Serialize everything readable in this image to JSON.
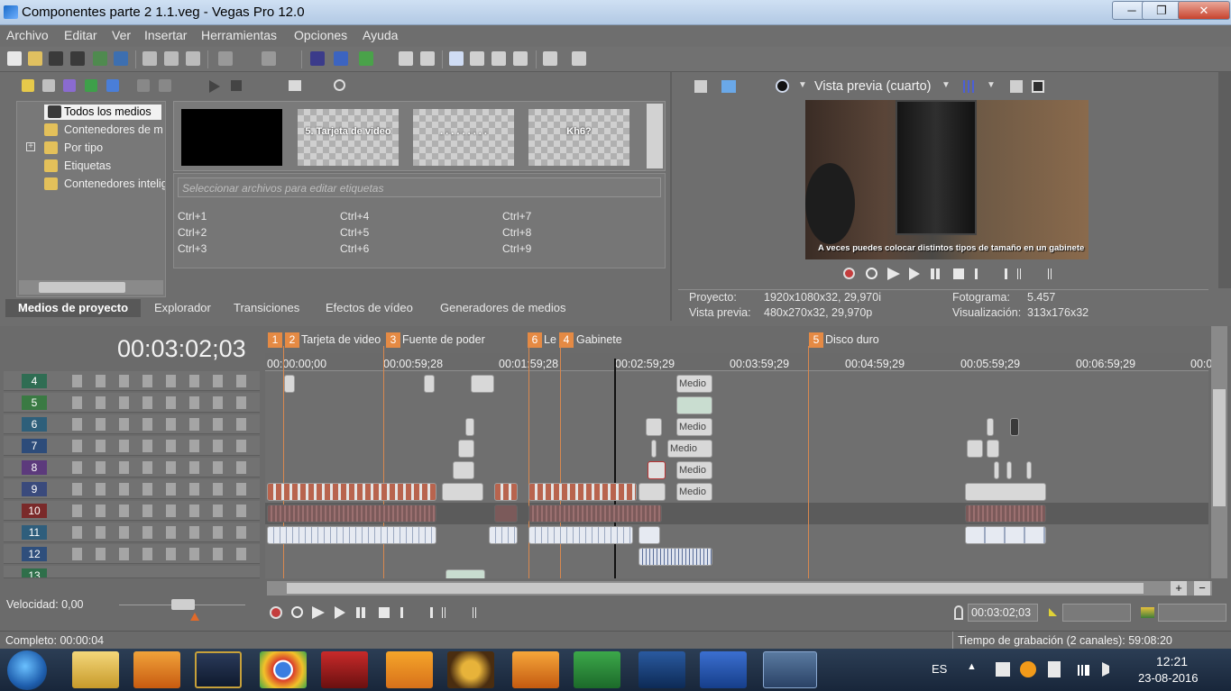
{
  "window": {
    "title": "Componentes parte 2 1.1.veg - Vegas Pro 12.0",
    "minimize": "─",
    "maximize": "❐",
    "close": "✕"
  },
  "menu": [
    "Archivo",
    "Editar",
    "Ver",
    "Insertar",
    "Herramientas",
    "Opciones",
    "Ayuda"
  ],
  "media": {
    "tree": [
      "Todos los medios",
      "Contenedores de m",
      "Por tipo",
      "Etiquetas",
      "Contenedores intelig"
    ],
    "thumbs": [
      "",
      "5. Tarjeta de video",
      ". . . . . . . . .",
      "Kh6?"
    ],
    "tag_placeholder": "Seleccionar archivos para editar etiquetas",
    "shortcuts": [
      "Ctrl+1",
      "Ctrl+4",
      "Ctrl+7",
      "Ctrl+2",
      "Ctrl+5",
      "Ctrl+8",
      "Ctrl+3",
      "Ctrl+6",
      "Ctrl+9"
    ],
    "tabs": [
      "Medios de proyecto",
      "Explorador",
      "Transiciones",
      "Efectos de vídeo",
      "Generadores de medios"
    ]
  },
  "preview": {
    "mode": "Vista previa (cuarto)",
    "subtitle": "A veces puedes colocar distintos tipos de tamaño en un gabinete",
    "proyecto_label": "Proyecto:",
    "proyecto_value": "1920x1080x32, 29,970i",
    "vista_label": "Vista previa:",
    "vista_value": "480x270x32, 29,970p",
    "fotograma_label": "Fotograma:",
    "fotograma_value": "5.457",
    "visual_label": "Visualización:",
    "visual_value": "313x176x32"
  },
  "timeline": {
    "time": "00:03:02;03",
    "markers": [
      {
        "n": "1",
        "label": ""
      },
      {
        "n": "2",
        "label": "Tarjeta de video"
      },
      {
        "n": "3",
        "label": "Fuente de poder"
      },
      {
        "n": "6",
        "label": "Le"
      },
      {
        "n": "4",
        "label": "Gabinete"
      },
      {
        "n": "5",
        "label": "Disco duro"
      }
    ],
    "ruler": [
      "00:00:00;00",
      "00:00:59;28",
      "00:01:59;28",
      "00:02:59;29",
      "00:03:59;29",
      "00:04:59;29",
      "00:05:59;29",
      "00:06:59;29",
      "00:0"
    ],
    "tracks": [
      "4",
      "5",
      "6",
      "7",
      "8",
      "9",
      "10",
      "11",
      "12",
      "13"
    ],
    "clip_text": "Medio",
    "speed_label": "Velocidad: 0,00",
    "transport_time": "00:03:02;03"
  },
  "status": {
    "left": "Completo: 00:00:04",
    "right": "Tiempo de grabación (2 canales): 59:08:20"
  },
  "taskbar": {
    "lang": "ES",
    "time": "12:21",
    "date": "23-08-2016"
  }
}
